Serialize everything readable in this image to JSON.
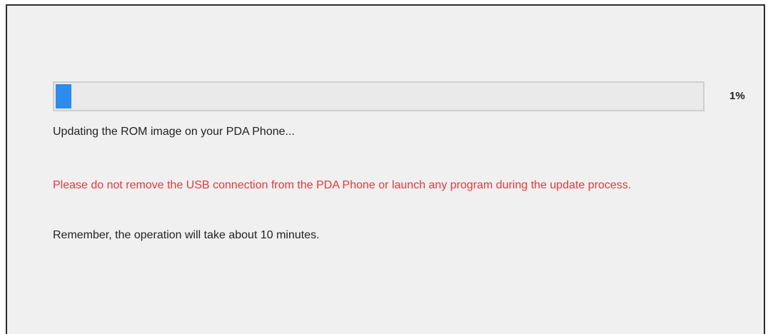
{
  "progress": {
    "percent_value": 0.01,
    "percent_label": "1%",
    "fill_color": "#2d8cf0"
  },
  "status_text": "Updating the ROM image on your PDA Phone...",
  "warning_text": "Please do not remove the USB connection from the PDA Phone or launch any program during the update process.",
  "reminder_text": "Remember, the operation will take about 10 minutes.",
  "colors": {
    "warning": "#e8373d",
    "background": "#f0f0f0"
  }
}
